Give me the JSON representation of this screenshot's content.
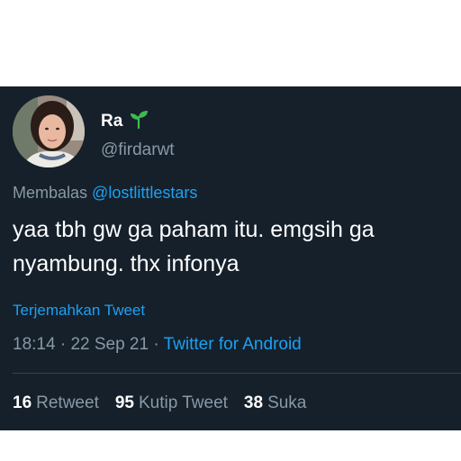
{
  "colors": {
    "background": "#15202b",
    "accent": "#1da1f2",
    "muted": "#8899a6",
    "text": "#ffffff",
    "divider": "#38444d"
  },
  "author": {
    "display_name": "Ra",
    "badge_icon": "sprout-icon",
    "handle": "@firdarwt"
  },
  "reply": {
    "prefix": "Membalas",
    "mention": "@lostlittlestars"
  },
  "tweet": {
    "text": "yaa tbh gw ga paham itu. emgsih ga nyambung. thx infonya",
    "translate_label": "Terjemahkan Tweet"
  },
  "meta": {
    "time": "18:14",
    "date": "22 Sep 21",
    "source": "Twitter for Android"
  },
  "stats": {
    "retweets": "16",
    "retweets_label": "Retweet",
    "quotes": "95",
    "quotes_label": "Kutip Tweet",
    "likes": "38",
    "likes_label": "Suka"
  }
}
